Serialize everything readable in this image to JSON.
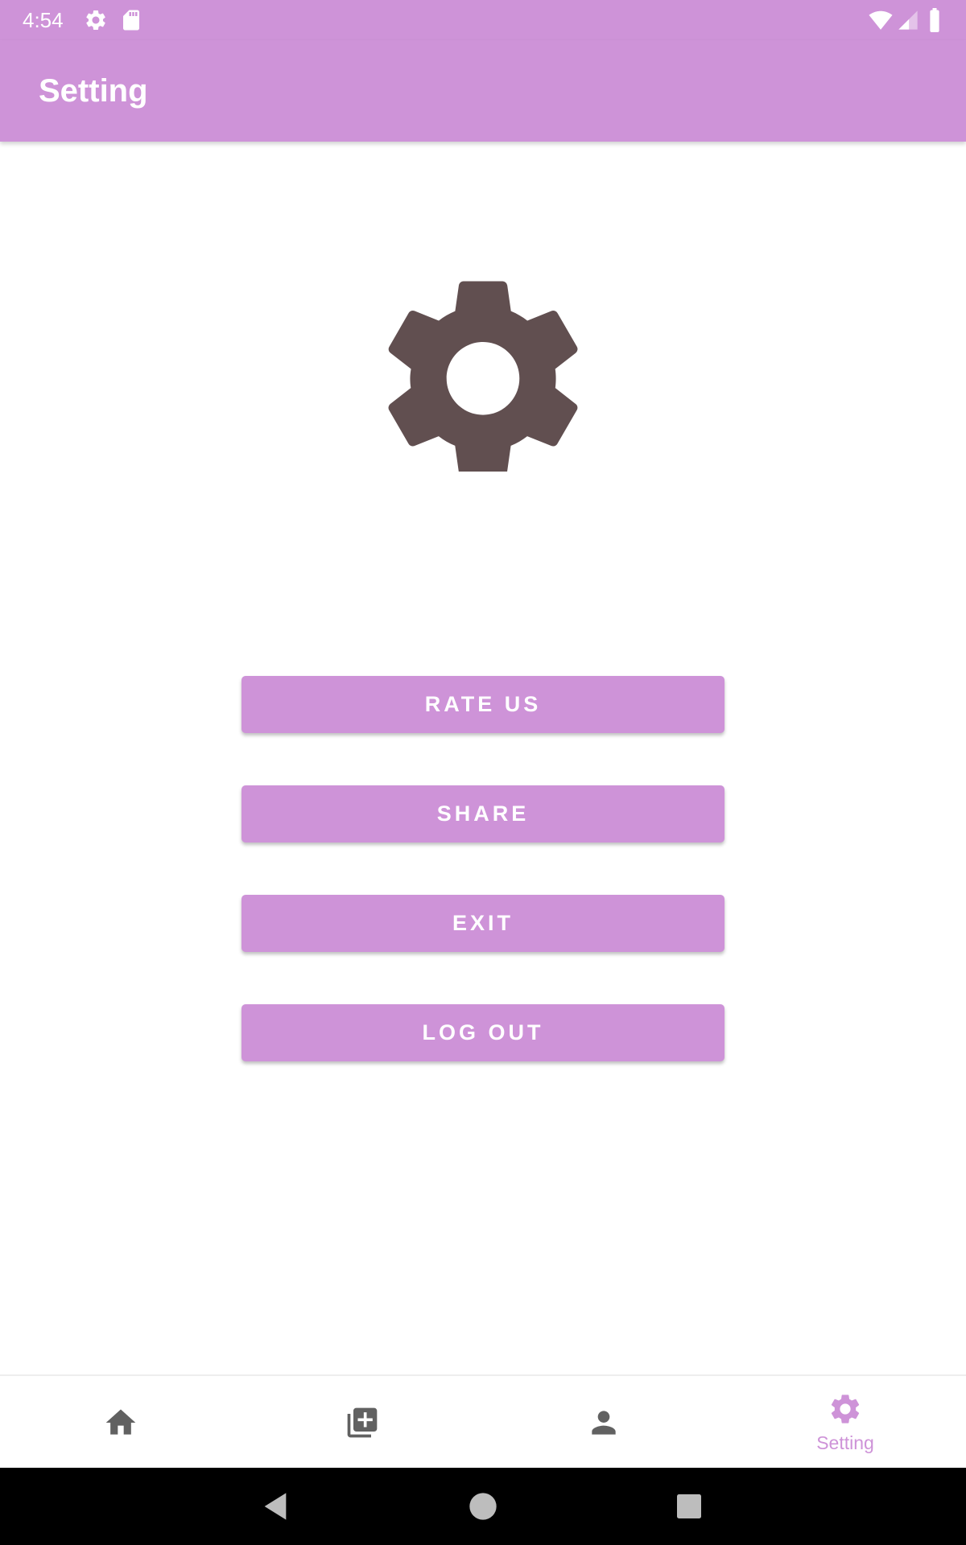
{
  "status_bar": {
    "time": "4:54",
    "icons": [
      "gear-icon",
      "sd-card-icon",
      "wifi-icon",
      "cell-signal-icon",
      "battery-icon"
    ]
  },
  "app_bar": {
    "title": "Setting"
  },
  "hero": {
    "icon": "gear-icon"
  },
  "actions": {
    "rate_us": "RATE US",
    "share": "SHARE",
    "exit": "EXIT",
    "log_out": "LOG OUT"
  },
  "bottom_nav": {
    "items": [
      {
        "icon": "home-icon",
        "label": ""
      },
      {
        "icon": "add-to-library-icon",
        "label": ""
      },
      {
        "icon": "person-icon",
        "label": ""
      },
      {
        "icon": "gear-icon",
        "label": "Setting",
        "selected": true
      }
    ]
  },
  "system_nav": {
    "buttons": [
      "back-icon",
      "home-circle-icon",
      "recents-icon"
    ]
  },
  "colors": {
    "accent": "#CE93D8",
    "icon_gray": "#616161",
    "hero_gear": "#614F50",
    "background": "#FFFFFF",
    "system_nav": "#000000"
  }
}
